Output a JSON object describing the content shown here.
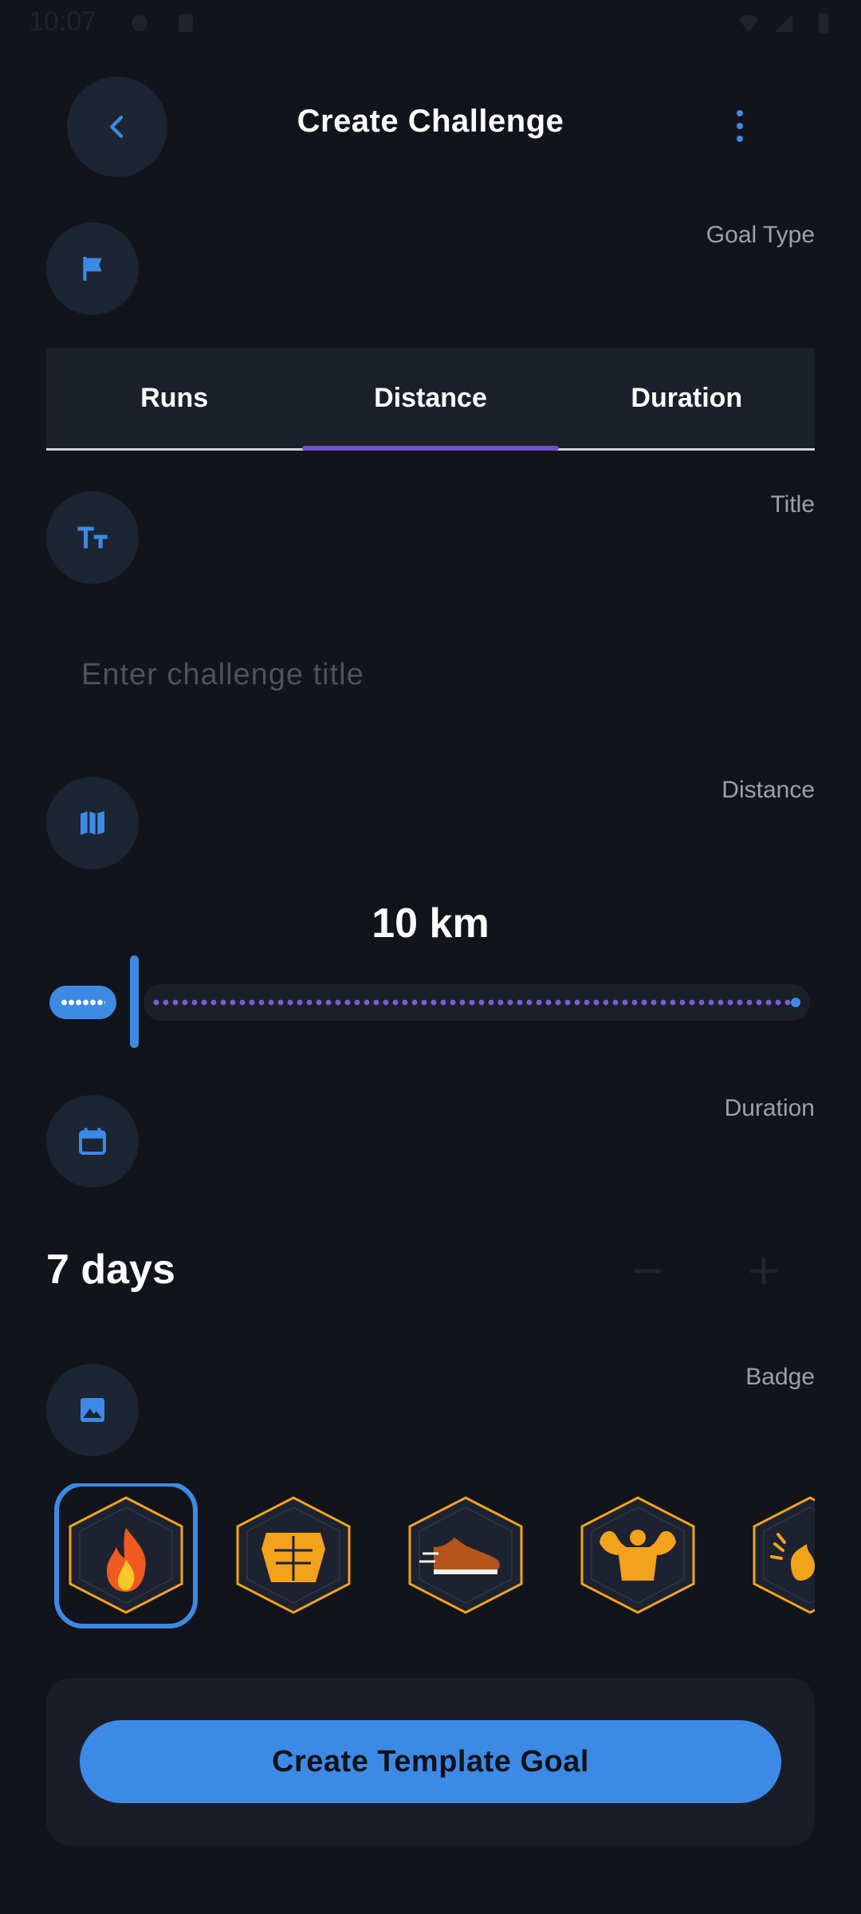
{
  "status_bar": {
    "time": "10:07"
  },
  "header": {
    "title": "Create Challenge"
  },
  "sections": {
    "goal_type": "Goal Type",
    "title": "Title",
    "distance": "Distance",
    "duration": "Duration",
    "badge": "Badge"
  },
  "tabs": [
    {
      "label": "Runs",
      "active": false
    },
    {
      "label": "Distance",
      "active": true
    },
    {
      "label": "Duration",
      "active": false
    }
  ],
  "title_input": {
    "value": "",
    "placeholder": "Enter challenge title"
  },
  "distance": {
    "value_label": "10 km",
    "slider_fraction": 0.0
  },
  "duration": {
    "value_label": "7 days",
    "decrement": "−",
    "increment": "+"
  },
  "badges": [
    {
      "icon": "flame-badge-icon",
      "selected": true
    },
    {
      "icon": "abs-badge-icon",
      "selected": false
    },
    {
      "icon": "shoe-badge-icon",
      "selected": false
    },
    {
      "icon": "flex-badge-icon",
      "selected": false
    },
    {
      "icon": "fire-badge-icon",
      "selected": false
    }
  ],
  "footer": {
    "button_label": "Create Template Goal"
  },
  "colors": {
    "accent": "#3d8ae6",
    "tab_indicator": "#6f52c9",
    "badge_gold": "#f3a21c",
    "background": "#11141b"
  }
}
